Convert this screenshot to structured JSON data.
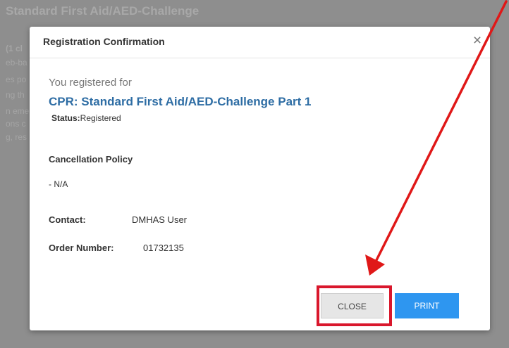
{
  "background": {
    "title": "Standard First Aid/AED-Challenge",
    "lines": [
      "(1 cl",
      "eb-ba",
      "es po",
      "ng th",
      "n eme",
      "ons c",
      "g, res"
    ]
  },
  "modal": {
    "title": "Registration Confirmation",
    "close_icon": "×",
    "intro": "You registered for",
    "course_name": "CPR: Standard First Aid/AED-Challenge Part 1",
    "status_label": "Status:",
    "status_value": "Registered",
    "cancellation_heading": "Cancellation Policy",
    "cancellation_value": "- N/A",
    "contact_label": "Contact:",
    "contact_value": "DMHAS User",
    "order_label": "Order Number:",
    "order_value": "01732135",
    "buttons": {
      "close": "CLOSE",
      "print": "PRINT"
    }
  },
  "colors": {
    "accent": "#2e6da4",
    "print_button": "#2e96f0",
    "annotation": "#d9172c"
  }
}
